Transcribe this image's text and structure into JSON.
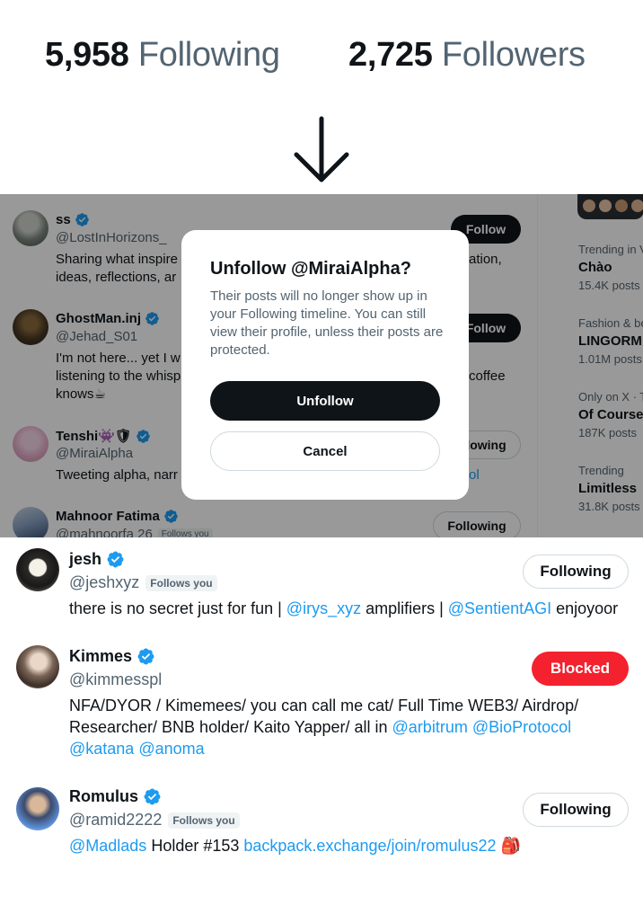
{
  "stats": {
    "following_count": "5,958",
    "following_label": "Following",
    "followers_count": "2,725",
    "followers_label": "Followers"
  },
  "mid_list": [
    {
      "name": "ss",
      "handle": "@LostInHorizons_",
      "bio_line1_left": "Sharing what inspire",
      "bio_line1_right": "ation,",
      "bio_line2": "ideas, reflections, ar",
      "button": "Follow"
    },
    {
      "name": "GhostMan.inj",
      "handle": "@Jehad_S01",
      "bio_line1_left": "I'm not here... yet I w",
      "bio_line2_left": "listening to the whisp",
      "bio_line2_right": "coffee",
      "bio_line3": "knows☕",
      "button": "Follow"
    },
    {
      "name": "Tenshi👾🛡",
      "handle": "@MiraiAlpha",
      "bio_line1_left": "Tweeting alpha, narr",
      "bio_line1_right": "ol",
      "button": "Following"
    },
    {
      "name": "Mahnoor Fatima",
      "handle": "@mahnoorfa 26",
      "follows_you": "Follows you",
      "button": "Following"
    }
  ],
  "trends": [
    {
      "category": "Trending in V",
      "title": "Chào",
      "count": "15.4K posts"
    },
    {
      "category": "Fashion & be",
      "title": "LINGORM",
      "count": "1.01M posts"
    },
    {
      "category": "Only on X · T",
      "title": "Of Course",
      "count": "187K posts"
    },
    {
      "category": "Trending",
      "title": "Limitless",
      "count": "31.8K posts"
    }
  ],
  "modal": {
    "title": "Unfollow @MiraiAlpha?",
    "body": "Their posts will no longer show up in your Following timeline. You can still view their profile, unless their posts are protected.",
    "confirm": "Unfollow",
    "cancel": "Cancel"
  },
  "bottom_list": [
    {
      "name": "jesh",
      "handle": "@jeshxyz",
      "follows_you": "Follows you",
      "bio_a": "there is no secret just for fun | ",
      "bio_link1": "@irys_xyz",
      "bio_b": " amplifiers | ",
      "bio_link2": "@SentientAGI",
      "bio_c": " enjoyoor",
      "button": "Following"
    },
    {
      "name": "Kimmes",
      "handle": "@kimmesspl",
      "bio_a": "NFA/DYOR / Kimemees/ you can call me cat/ Full Time WEB3/ Airdrop/ Researcher/ BNB holder/ Kaito Yapper/ all in ",
      "bio_link1": "@arbitrum",
      "bio_b": " ",
      "bio_link2": "@BioProtocol",
      "bio_c": " ",
      "bio_link3": "@katana",
      "bio_d": " ",
      "bio_link4": "@anoma",
      "button": "Blocked"
    },
    {
      "name": "Romulus",
      "handle": "@ramid2222",
      "follows_you": "Follows you",
      "bio_link1": "@Madlads",
      "bio_a": " Holder #153 ",
      "bio_link2": "backpack.exchange/join/romulus22",
      "bio_b": " 🎒",
      "button": "Following"
    }
  ],
  "colors": {
    "text": "#0f1419",
    "muted": "#536471",
    "link": "#1d9bf0",
    "verified": "#1d9bf0",
    "blocked": "#f4212e",
    "border": "#cfd9de"
  },
  "icons": {
    "arrow": "arrow-down-icon",
    "verified": "verified-badge-icon"
  }
}
